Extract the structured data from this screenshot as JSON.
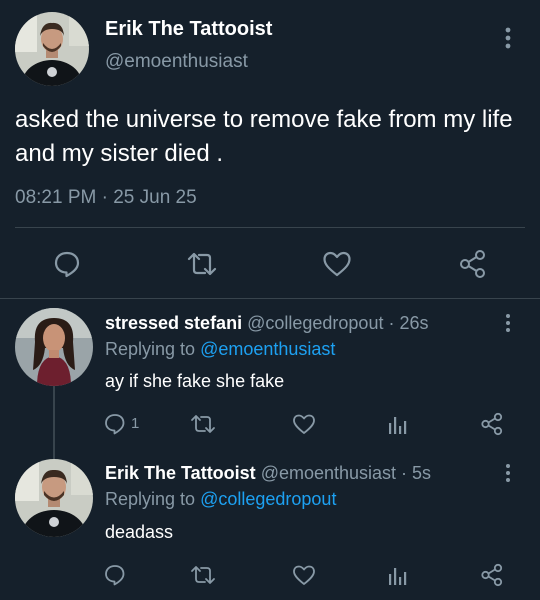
{
  "main_tweet": {
    "display_name": "Erik The Tattooist",
    "handle": "@emoenthusiast",
    "text": "asked the universe to remove fake from my life and my sister died .",
    "time": "08:21 PM",
    "separator": "·",
    "date": "25 Jun 25"
  },
  "replies": [
    {
      "display_name": "stressed stefani",
      "meta": "@collegedropout · 26s",
      "replying_prefix": "Replying to",
      "replying_to": "@emoenthusiast",
      "text": "ay if she fake she fake",
      "reply_count": "1"
    },
    {
      "display_name": "Erik The Tattooist",
      "meta": "@emoenthusiast · 5s",
      "replying_prefix": "Replying to",
      "replying_to": "@collegedropout",
      "text": "deadass",
      "reply_count": ""
    }
  ],
  "colors": {
    "background": "#15202b",
    "secondary_text": "#8899a6",
    "link": "#1da1f2",
    "divider": "#38444d"
  },
  "icons": [
    "more-icon",
    "reply-icon",
    "retweet-icon",
    "like-icon",
    "share-icon",
    "analytics-icon"
  ]
}
